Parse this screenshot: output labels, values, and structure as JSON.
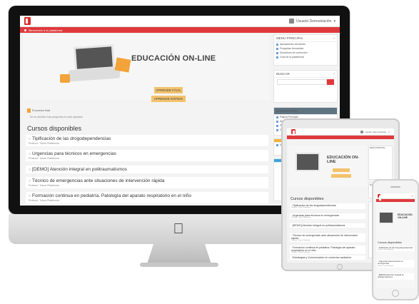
{
  "imac": {
    "user_name": "Usuario Demostración",
    "banner": "Bienvenido a la plataforma",
    "hero_title": "EDUCACIÓN ON-LINE",
    "btn_primary": "APRENDE FÁCIL",
    "btn_secondary": "APRENDE RÁPIDO",
    "notice_title": "Encuesta final",
    "notice_sub": "No se admiten más preguntas en este apartado",
    "courses_heading": "Cursos disponibles",
    "courses": [
      {
        "title": "Tipificación de las drogodependencias",
        "teacher": "Profesor: Tutora Plataforma"
      },
      {
        "title": "Urgencias para técnicos en emergencias",
        "teacher": "Profesor: Tutora Plataforma"
      },
      {
        "title": "[DEMO] Atención integral en politraumatismos",
        "teacher": ""
      },
      {
        "title": "Técnico de emergencias ante situaciones de intervención rápida",
        "teacher": "Profesor: Tutora Plataforma"
      },
      {
        "title": "Formación continua en pediatría. Patología del aparato respiratorio en el niño",
        "teacher": "Profesor: Tutora Plataforma"
      }
    ],
    "side": {
      "menu_h": "MENÚ PRINCIPAL",
      "menu_items": [
        "Aplicaciones de interés",
        "Preguntas frecuentes",
        "Directrices de corrección",
        "Guía de la plataforma"
      ],
      "search_h": "BUSCAR",
      "nav_h": "NAVEGACIÓN",
      "nav_items": [
        "Página Principal",
        "Área personal",
        "Páginas del sitio",
        "Cursos"
      ],
      "msg_text": "Mensajes"
    }
  },
  "ipad": {
    "user_name": "Usuario Demostración",
    "hero_title": "EDUCACIÓN ON-LINE",
    "courses_heading": "Cursos disponibles",
    "courses": [
      {
        "title": "Tipificación de las drogodependencias",
        "teacher": "Profesor: Tutora Plataforma"
      },
      {
        "title": "Urgencias para técnicos en emergencias",
        "teacher": "Profesor: Tutora Plataforma"
      },
      {
        "title": "[DEMO] Atención integral en politraumatismos",
        "teacher": ""
      },
      {
        "title": "Técnico de emergencias ante situaciones de intervención rápida",
        "teacher": "Profesor: Tutora Plataforma"
      },
      {
        "title": "Formación continua en pediatría. Patología del aparato respiratorio en el niño",
        "teacher": "Profesor: Tutora Plataforma"
      },
      {
        "title": "Estrategias y Comunicación en contextos sanitarios",
        "teacher": "Profesor: Tutora Plataforma"
      }
    ],
    "side_menu_h": "MENÚ PRINCIPAL",
    "side_search_h": "BUSCAR"
  },
  "iphone": {
    "hero_title": "EDUCACIÓN ON-LINE",
    "courses_heading": "Cursos disponibles",
    "courses": [
      {
        "title": "Tipificación de las drogodependencias",
        "teacher": "Profesor: Tutora Plataforma"
      },
      {
        "title": "Urgencias para técnicos en emergencias",
        "teacher": "Profesor: Tutora Plataforma"
      },
      {
        "title": "[DEMO] Atención integral en politraumatismos",
        "teacher": ""
      }
    ]
  },
  "colors": {
    "brand_red": "#e0393c",
    "accent_orange": "#f3c26c",
    "nav_slate": "#5e7481"
  }
}
